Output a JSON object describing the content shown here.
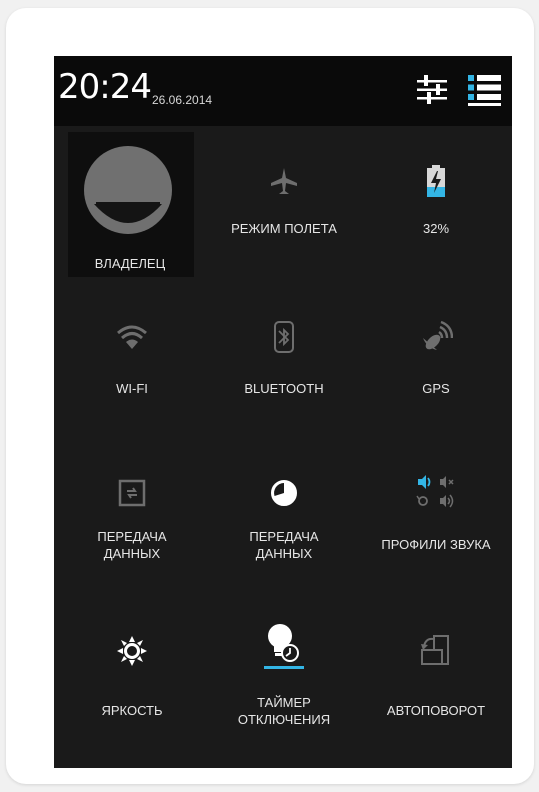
{
  "status_bar": {
    "time": "20:24",
    "date": "26.06.2014",
    "settings_icon": "sliders-icon",
    "notifications_icon": "list-icon"
  },
  "owner": {
    "label": "ВЛАДЕЛЕЦ",
    "icon": "avatar"
  },
  "tiles": [
    {
      "label": "РЕЖИМ ПОЛЕТА",
      "icon": "airplane-icon"
    },
    {
      "label": "32%",
      "icon": "battery-charging-icon",
      "battery_level": 0.32
    },
    {
      "label": "WI-FI",
      "icon": "wifi-icon"
    },
    {
      "label": "BLUETOOTH",
      "icon": "bluetooth-icon"
    },
    {
      "label": "GPS",
      "icon": "gps-icon"
    },
    {
      "label": "ПЕРЕДАЧА\nДАННЫХ",
      "icon": "data-transfer-icon"
    },
    {
      "label": "ПЕРЕДАЧА\nДАННЫХ",
      "icon": "data-usage-icon"
    },
    {
      "label": "ПРОФИЛИ ЗВУКА",
      "icon": "sound-profiles-icon"
    },
    {
      "label": "ЯРКОСТЬ",
      "icon": "brightness-icon"
    },
    {
      "label": "ТАЙМЕР\nОТКЛЮЧЕНИЯ",
      "icon": "sleep-timer-icon"
    },
    {
      "label": "АВТОПОВОРОТ",
      "icon": "auto-rotate-icon"
    }
  ],
  "colors": {
    "accent": "#33b5e5",
    "panel_bg": "#1a1a1a",
    "status_bg": "#0a0a0a",
    "icon_dim": "#6e6e6e"
  }
}
